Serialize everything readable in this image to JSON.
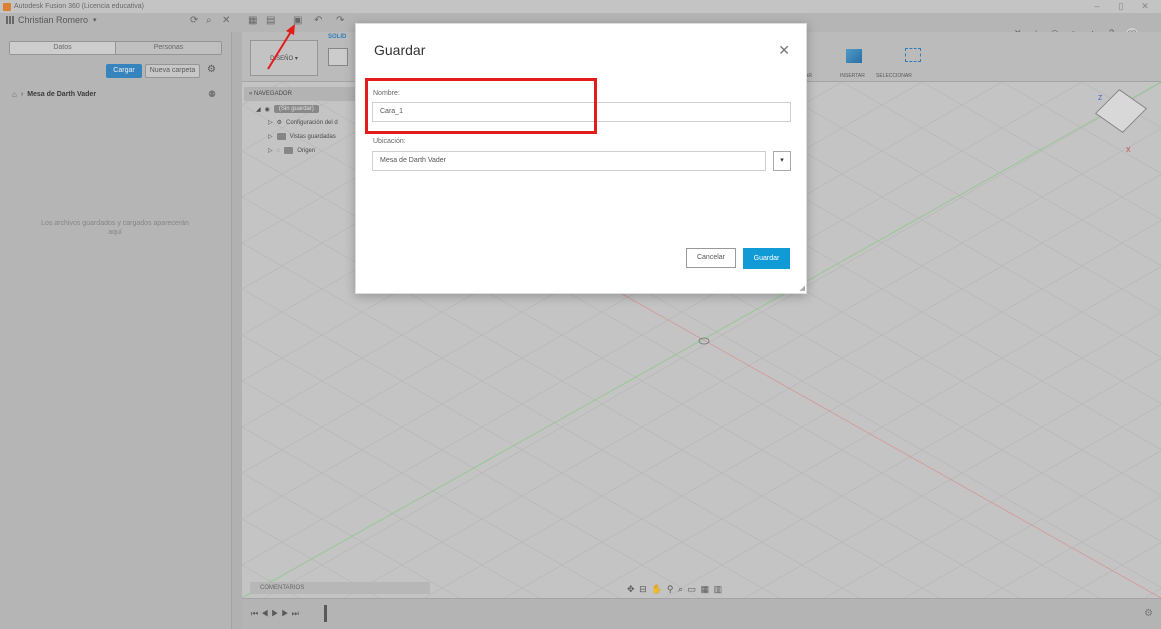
{
  "window": {
    "title": "Autodesk Fusion 360 (Licencia educativa)"
  },
  "header": {
    "user_name": "Christian Romero",
    "initials": "CR"
  },
  "left_panel": {
    "tabs": [
      "Datos",
      "Personas"
    ],
    "upload_label": "Cargar",
    "new_folder_label": "Nueva carpeta",
    "breadcrumb": "Mesa de Darth Vader",
    "empty_message": "Los archivos guardados y cargados aparecerán aquí"
  },
  "toolbar": {
    "workspace_label": "DISEÑO",
    "active_tab": "SOLID",
    "insert_label": "INSERTAR",
    "select_label": "SELECCIONAR",
    "partial_label": "AR"
  },
  "navigator": {
    "title": "NAVEGADOR",
    "root_label": "(Sin guardar)",
    "items": [
      "Configuración del d",
      "Vistas guardadas",
      "Origen"
    ]
  },
  "comments_label": "COMENTARIOS",
  "viewcube": {
    "z": "Z",
    "x": "X"
  },
  "dialog": {
    "title": "Guardar",
    "name_label": "Nombre:",
    "name_value": "Cara_1",
    "location_label": "Ubicación:",
    "location_value": "Mesa de Darth Vader",
    "cancel_label": "Cancelar",
    "save_label": "Guardar"
  },
  "colors": {
    "accent": "#119bd6",
    "upload_button": "#2c86c8",
    "highlight": "#e21b1b"
  }
}
